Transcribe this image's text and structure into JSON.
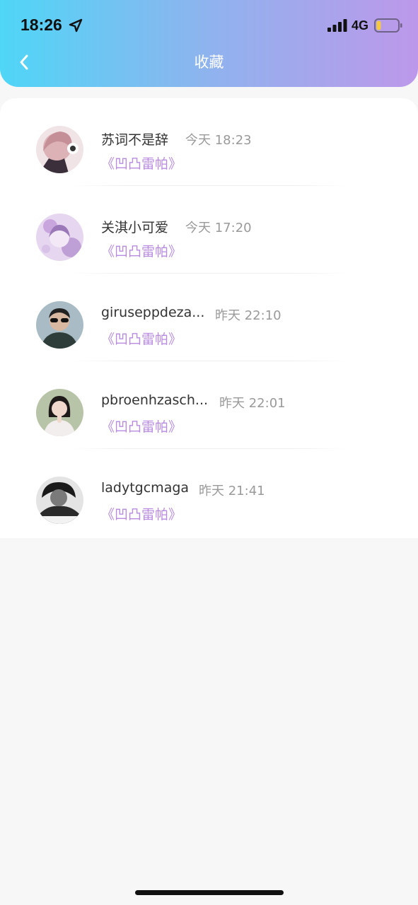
{
  "status_bar": {
    "time": "18:26",
    "network": "4G",
    "battery_level": 0.2
  },
  "header": {
    "title": "收藏",
    "gradient": [
      "#4fd6f7",
      "#bd98ea"
    ]
  },
  "accent_color": "#b88be0",
  "items": [
    {
      "name": "苏词不是辞",
      "time": "今天 18:23",
      "book": "《凹凸雷帕》",
      "avatar": "avatar-anime-girl"
    },
    {
      "name": "关淇小可爱",
      "time": "今天 17:20",
      "book": "《凹凸雷帕》",
      "avatar": "avatar-purple-art"
    },
    {
      "name": "giruseppdeza...",
      "time": "昨天 22:10",
      "book": "《凹凸雷帕》",
      "avatar": "avatar-man-sunglasses"
    },
    {
      "name": "pbroenhzasch...",
      "time": "昨天 22:01",
      "book": "《凹凸雷帕》",
      "avatar": "avatar-girl-hands"
    },
    {
      "name": "ladytgcmaga",
      "time": "昨天 21:41",
      "book": "《凹凸雷帕》",
      "avatar": "avatar-man-bw"
    }
  ]
}
